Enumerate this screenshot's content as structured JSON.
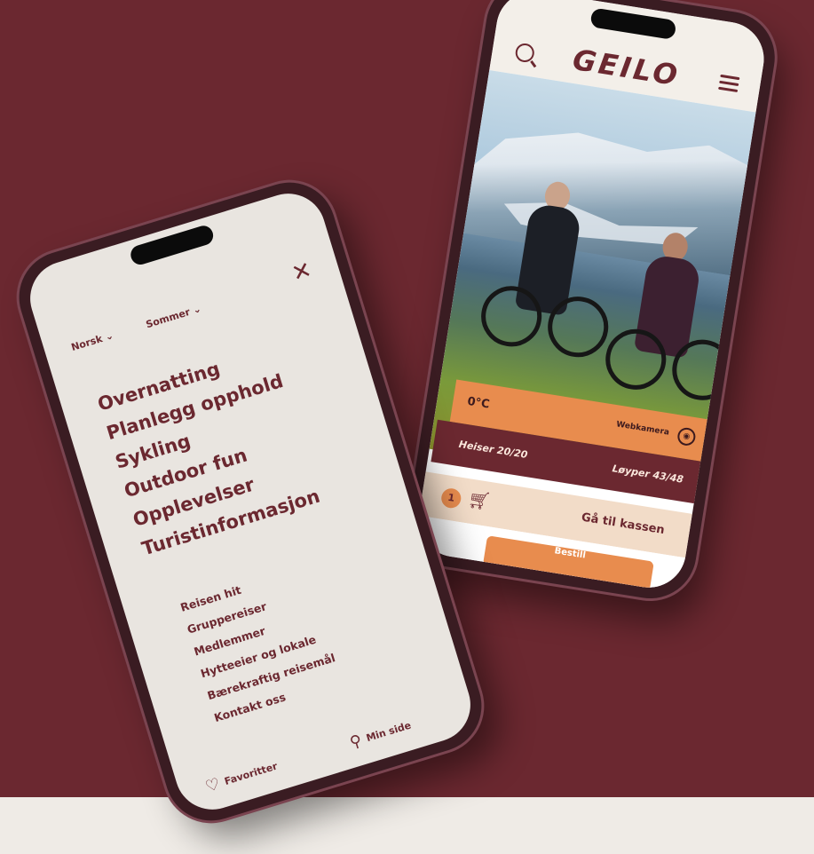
{
  "colors": {
    "background": "#6b2830",
    "accent": "#e88c4e",
    "dark": "#6b2830",
    "menu_bg": "#e9e5e0"
  },
  "app_phone": {
    "logo": "GEILO",
    "icons": {
      "search": "search-icon",
      "menu": "hamburger-menu-icon",
      "cart": "cart-icon",
      "webcam": "webcam-icon"
    },
    "weather": {
      "temperature": "0°C",
      "webcam_label": "Webkamera"
    },
    "lifts": {
      "lifts_label": "Heiser 20/20",
      "slopes_label": "Løyper 43/48"
    },
    "cart_bar": {
      "badge": "1",
      "checkout_label": "Gå til kassen"
    },
    "cta": {
      "label": "Bestill"
    }
  },
  "menu_phone": {
    "language": "Norsk ⌄",
    "season": "Sommer ⌄",
    "close_icon": "close-icon",
    "main_items": [
      "Overnatting",
      "Planlegg opphold",
      "Sykling",
      "Outdoor fun",
      "Opplevelser",
      "Turistinformasjon"
    ],
    "secondary_items": [
      "Reisen hit",
      "Gruppereiser",
      "Medlemmer",
      "Hytteeier og lokale",
      "Bærekraftig reisemål",
      "Kontakt oss"
    ],
    "favorites_label": "Favoritter",
    "my_page_label": "Min side"
  }
}
